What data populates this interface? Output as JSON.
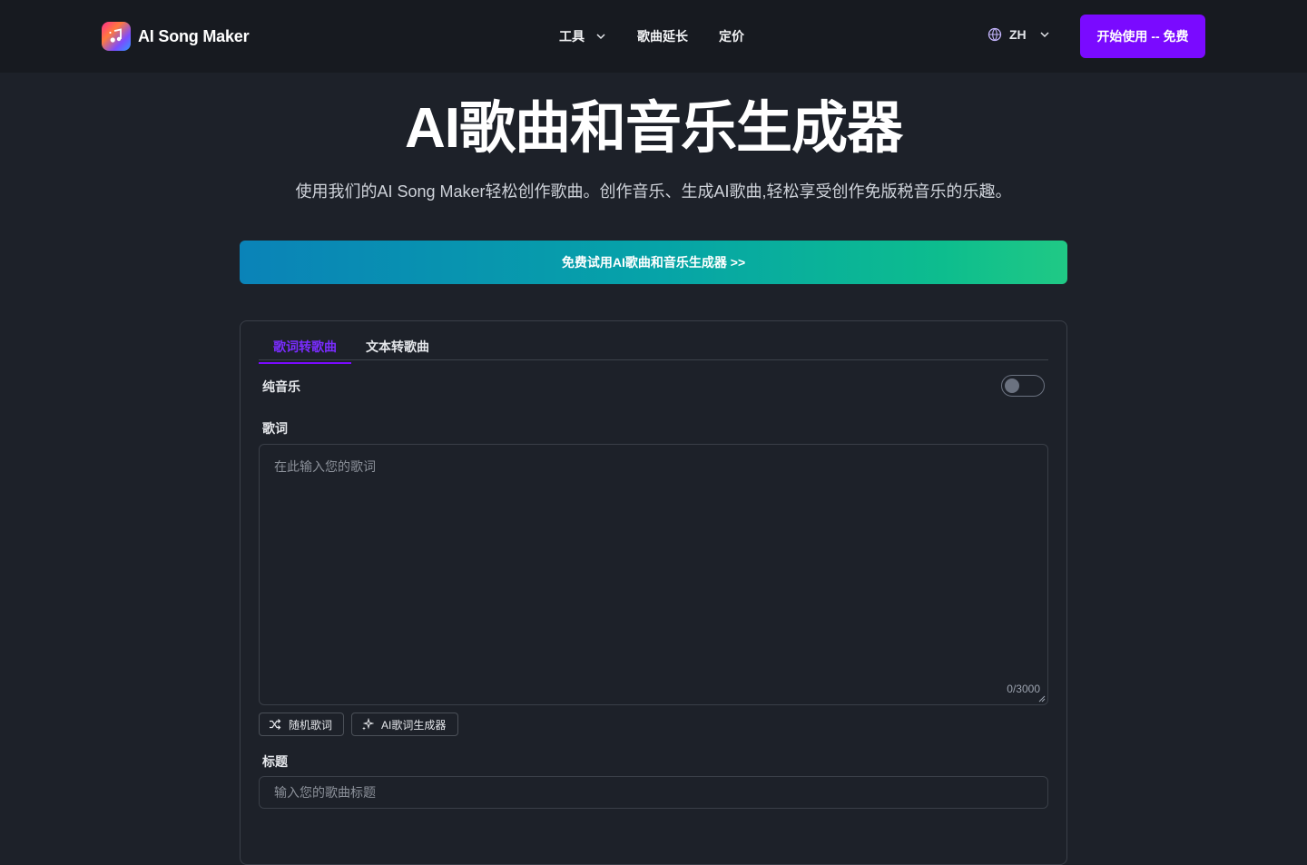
{
  "header": {
    "logo_text": "AI Song Maker",
    "nav": {
      "tools": "工具",
      "extend": "歌曲延长",
      "pricing": "定价"
    },
    "language": "ZH",
    "cta": "开始使用 -- 免费"
  },
  "hero": {
    "title": "AI歌曲和音乐生成器",
    "subtitle": "使用我们的AI Song Maker轻松创作歌曲。创作音乐、生成AI歌曲,轻松享受创作免版税音乐的乐趣。",
    "banner": "免费试用AI歌曲和音乐生成器 >>"
  },
  "form": {
    "tabs": [
      {
        "label": "歌词转歌曲",
        "active": true
      },
      {
        "label": "文本转歌曲",
        "active": false
      }
    ],
    "instrumental_label": "纯音乐",
    "instrumental_on": false,
    "lyrics_label": "歌词",
    "lyrics_placeholder": "在此输入您的歌词",
    "lyrics_counter": "0/3000",
    "random_lyrics": "随机歌词",
    "ai_lyrics_generator": "AI歌词生成器",
    "title_label": "标题",
    "title_placeholder": "输入您的歌曲标题"
  },
  "colors": {
    "accent": "#7a0aff",
    "background": "#1d2129",
    "header_bg": "#171a20"
  }
}
